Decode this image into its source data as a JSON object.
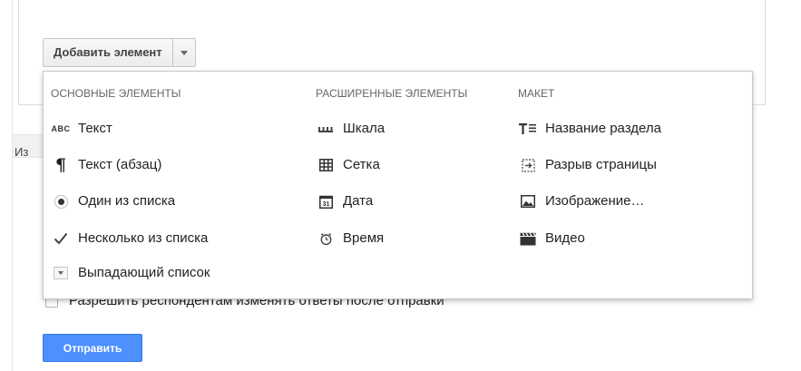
{
  "toolbar": {
    "add_element_label": "Добавить элемент"
  },
  "background": {
    "peek_text": "Из",
    "allow_edit_label": "Разрешить респондентам изменять ответы после отправки",
    "submit_label": "Отправить"
  },
  "menu": {
    "basic": {
      "header": "ОСНОВНЫЕ ЭЛЕМЕНТЫ",
      "items": [
        {
          "label": "Текст",
          "icon": "abc-text-icon"
        },
        {
          "label": "Текст (абзац)",
          "icon": "paragraph-icon"
        },
        {
          "label": "Один из списка",
          "icon": "radio-button-icon"
        },
        {
          "label": "Несколько из списка",
          "icon": "checkmark-icon"
        },
        {
          "label": "Выпадающий список",
          "icon": "dropdown-icon"
        }
      ]
    },
    "advanced": {
      "header": "РАСШИРЕННЫЕ ЭЛЕМЕНТЫ",
      "items": [
        {
          "label": "Шкала",
          "icon": "scale-icon"
        },
        {
          "label": "Сетка",
          "icon": "grid-icon"
        },
        {
          "label": "Дата",
          "icon": "calendar-icon",
          "glyph": "31"
        },
        {
          "label": "Время",
          "icon": "clock-icon"
        }
      ]
    },
    "layout": {
      "header": "МАКЕТ",
      "items": [
        {
          "label": "Название раздела",
          "icon": "section-title-icon"
        },
        {
          "label": "Разрыв страницы",
          "icon": "page-break-icon"
        },
        {
          "label": "Изображение…",
          "icon": "image-icon"
        },
        {
          "label": "Видео",
          "icon": "video-icon"
        }
      ]
    }
  },
  "colors": {
    "submit_bg": "#4d90fe",
    "menu_border": "#c8c8c8",
    "header_text": "#666666"
  }
}
